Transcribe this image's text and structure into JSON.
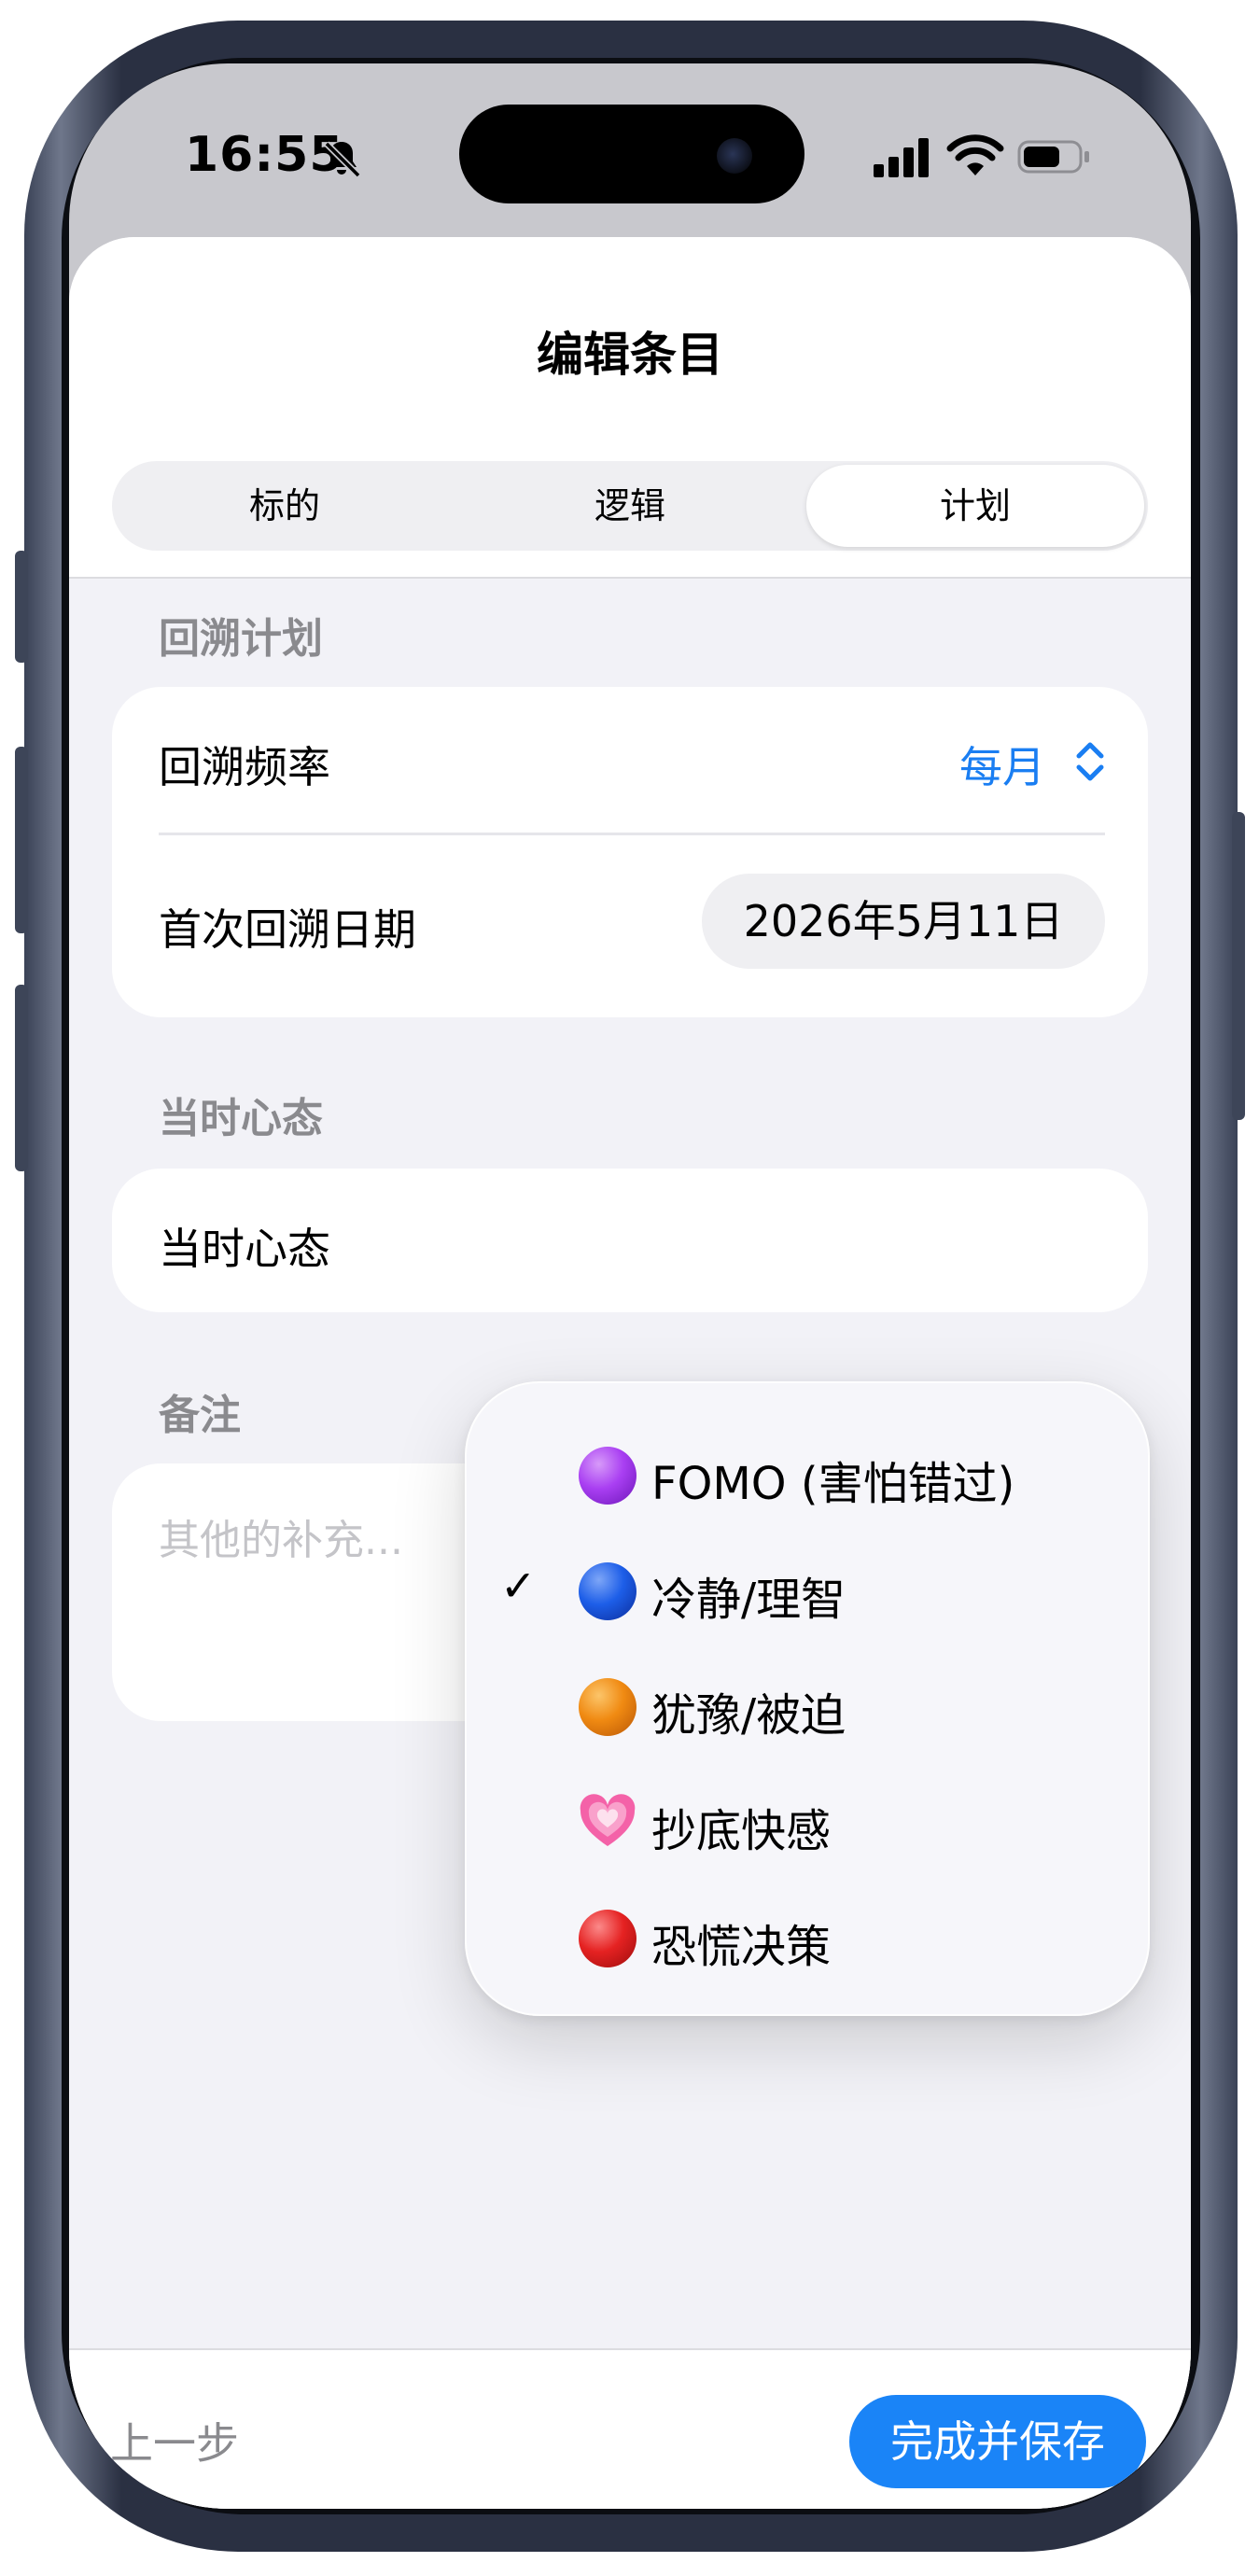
{
  "status_bar": {
    "time": "16:55"
  },
  "sheet": {
    "title": "编辑条目"
  },
  "tabs": [
    {
      "label": "标的"
    },
    {
      "label": "逻辑"
    },
    {
      "label": "计划",
      "active": true
    }
  ],
  "review_plan": {
    "section_label": "回溯计划",
    "frequency_label": "回溯频率",
    "frequency_value": "每月",
    "first_date_label": "首次回溯日期",
    "first_date_value": "2026年5月11日"
  },
  "mindset": {
    "section_label": "当时心态",
    "row_label": "当时心态",
    "options": [
      {
        "label": "FOMO (害怕错过)",
        "icon": "purple-circle-icon",
        "color": "#a93ff2",
        "selected": false
      },
      {
        "label": "冷静/理智",
        "icon": "blue-circle-icon",
        "color": "#1d5ee8",
        "selected": true
      },
      {
        "label": "犹豫/被迫",
        "icon": "orange-circle-icon",
        "color": "#f08a12",
        "selected": false
      },
      {
        "label": "抄底快感",
        "icon": "growing-heart-icon",
        "color": "#f462a8",
        "selected": false
      },
      {
        "label": "恐慌决策",
        "icon": "red-circle-icon",
        "color": "#e52222",
        "selected": false
      }
    ],
    "check_mark": "✓"
  },
  "notes": {
    "section_label": "备注",
    "placeholder": "其他的补充..."
  },
  "footer": {
    "back_label": "上一步",
    "save_label": "完成并保存"
  },
  "colors": {
    "accent": "#1a84f7",
    "link": "#1a7ef2",
    "background": "#f2f2f7"
  }
}
